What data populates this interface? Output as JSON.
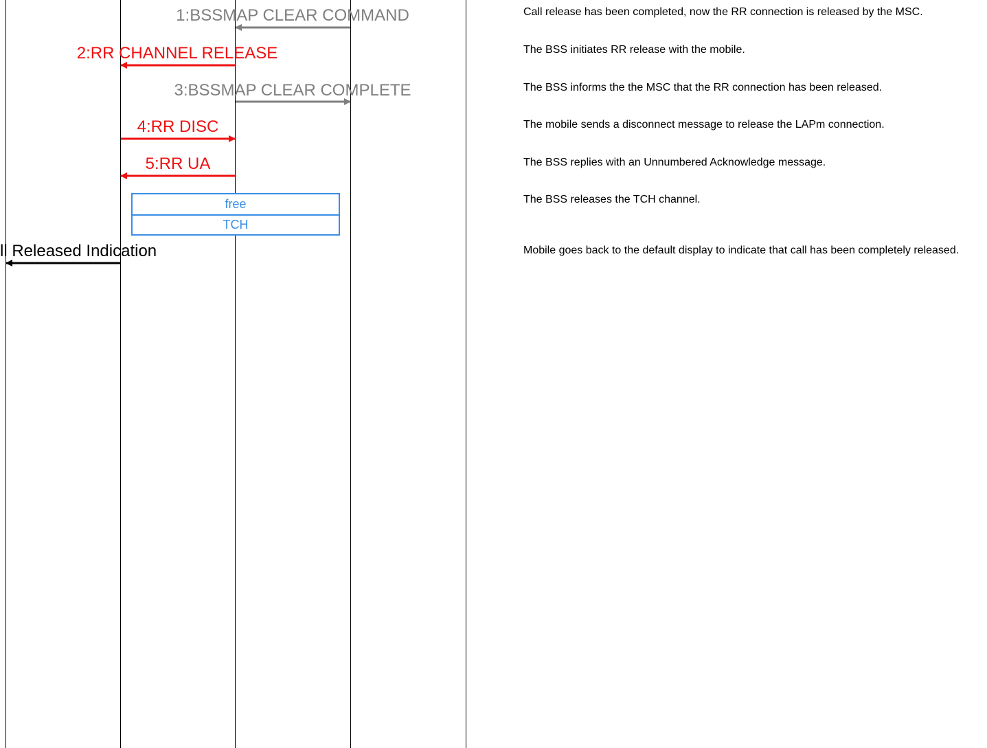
{
  "colors": {
    "grey": "#7f7f7f",
    "red": "#ee1111",
    "black": "#000000",
    "blue": "#3a8ee6"
  },
  "messages": [
    {
      "label": "1:BSSMAP CLEAR COMMAND",
      "color": "#7f7f7f"
    },
    {
      "label": "2:RR CHANNEL RELEASE",
      "color": "#ee1111"
    },
    {
      "label": "3:BSSMAP CLEAR COMPLETE",
      "color": "#7f7f7f"
    },
    {
      "label": "4:RR DISC",
      "color": "#ee1111"
    },
    {
      "label": "5:RR UA",
      "color": "#ee1111"
    },
    {
      "label": "ll Released Indication",
      "color": "#000000"
    }
  ],
  "action_box": {
    "line1": "free",
    "line2": "TCH"
  },
  "descriptions": [
    "Call release has been completed, now the RR connection is released by the MSC.",
    "The BSS initiates RR release with the mobile.",
    "The BSS informs the the MSC that the RR connection has been released.",
    "The mobile sends a disconnect message to release the LAPm connection.",
    "The BSS replies with an Unnumbered Acknowledge message.",
    "The BSS releases the TCH channel.",
    "Mobile goes back to the default display to indicate that call has been completely released."
  ]
}
